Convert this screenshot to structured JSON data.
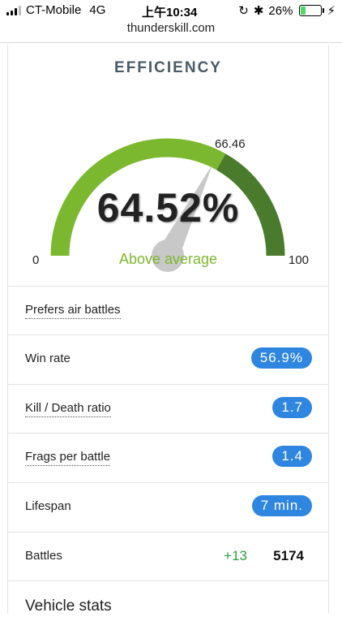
{
  "status": {
    "carrier": "CT-Mobile",
    "network": "4G",
    "time": "上午10:34",
    "battery": "26%"
  },
  "browser": {
    "url": "thunderskill.com"
  },
  "efficiency": {
    "title": "EFFICIENCY",
    "value_label": "64.52%",
    "value": 64.52,
    "average_label": "66.46",
    "average": 66.46,
    "min_label": "0",
    "max_label": "100",
    "rating": "Above average",
    "colors": {
      "light_green": "#7cb82f",
      "dark_green": "#4a7a2b",
      "needle": "#c8c8c8",
      "rating_text": "#7cb82f"
    }
  },
  "stats": {
    "prefers": "Prefers air battles",
    "win_rate_label": "Win rate",
    "win_rate_value": "56.9%",
    "kd_label": "Kill / Death ratio",
    "kd_value": "1.7",
    "frags_label": "Frags per battle",
    "frags_value": "1.4",
    "lifespan_label": "Lifespan",
    "lifespan_value": "7 min.",
    "battles_label": "Battles",
    "battles_delta": "+13",
    "battles_value": "5174",
    "badge_color": "#2f86e0"
  },
  "vehicle": {
    "title": "Vehicle stats"
  }
}
